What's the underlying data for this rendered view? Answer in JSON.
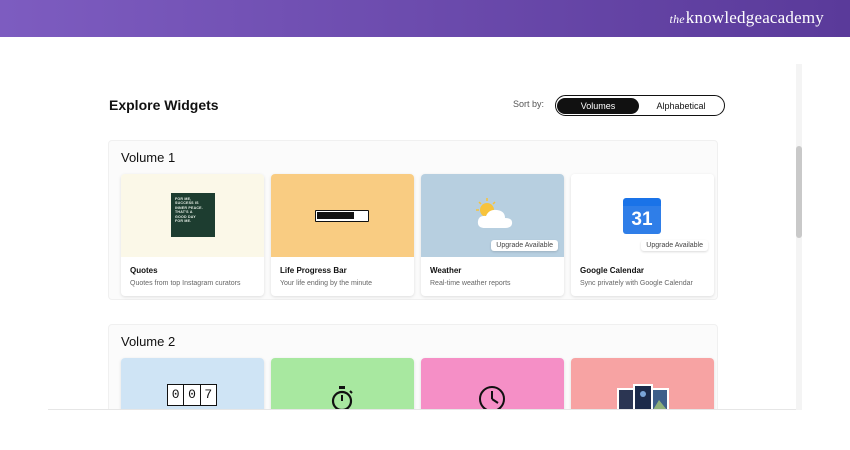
{
  "brand": {
    "prefix": "the",
    "name": "knowledgeacademy"
  },
  "header": {
    "title": "Explore Widgets",
    "sort_label": "Sort by:",
    "sort_options": [
      "Volumes",
      "Alphabetical"
    ],
    "sort_selected": "Volumes"
  },
  "volumes": [
    {
      "title": "Volume 1",
      "cards": [
        {
          "title": "Quotes",
          "description": "Quotes from top Instagram curators",
          "color": "#fbf8e8",
          "preview_lines": [
            "FOR ME,",
            "SUCCESS IS",
            "INNER PEACE.",
            "THAT'S A",
            "GOOD DAY",
            "FOR ME."
          ]
        },
        {
          "title": "Life Progress Bar",
          "description": "Your life ending by the minute",
          "color": "#f9cc82",
          "progress": 0.75
        },
        {
          "title": "Weather",
          "description": "Real-time weather reports",
          "color": "#b7cfe0",
          "badge": "Upgrade Available"
        },
        {
          "title": "Google Calendar",
          "description": "Sync privately with Google Calendar",
          "color": "#ffffff",
          "badge": "Upgrade Available",
          "calendar_day": "31"
        }
      ]
    },
    {
      "title": "Volume 2",
      "cards": [
        {
          "color": "#cfe4f5",
          "digits": [
            "0",
            "0",
            "7"
          ]
        },
        {
          "color": "#a8e8a0"
        },
        {
          "color": "#f58fc6"
        },
        {
          "color": "#f7a3a3"
        }
      ]
    }
  ],
  "icons": [
    "weather-sun-cloud-icon",
    "stopwatch-icon",
    "clock-icon",
    "photo-stack-icon",
    "calendar-icon"
  ]
}
